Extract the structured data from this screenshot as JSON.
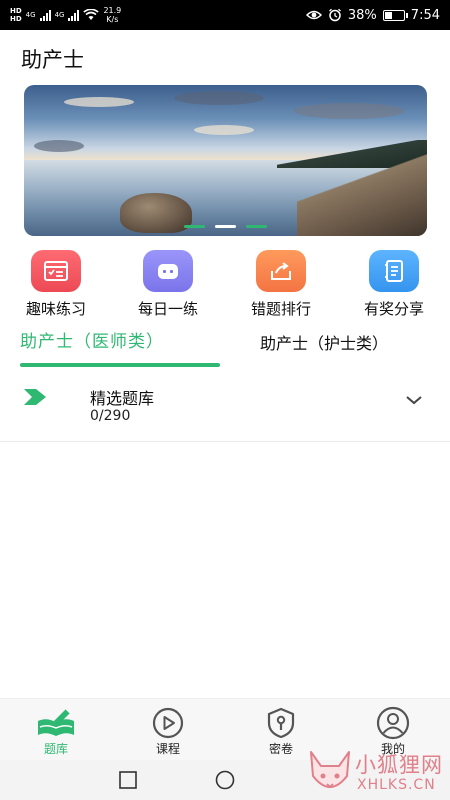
{
  "status_bar": {
    "hd1": "HD",
    "hd2": "HD",
    "net1": "4G",
    "net2": "4G",
    "speed_value": "21.9",
    "speed_unit": "K/s",
    "battery": "38%",
    "battery_level": 0.38,
    "time": "7:54"
  },
  "app": {
    "title": "助产士"
  },
  "banner": {
    "slide_count": 3,
    "active_slide": 2
  },
  "quick_actions": [
    {
      "label": "趣味练习",
      "icon": "practice-icon",
      "color": "#f0555f"
    },
    {
      "label": "每日一练",
      "icon": "robot-icon",
      "color": "#8b86f2"
    },
    {
      "label": "错题排行",
      "icon": "rank-share-icon",
      "color": "#f7874e"
    },
    {
      "label": "有奖分享",
      "icon": "notebook-icon",
      "color": "#3fa2f2"
    }
  ],
  "tabs": [
    {
      "label": "助产士（医师类）",
      "active": true
    },
    {
      "label": "助产士（护士类）",
      "active": false
    }
  ],
  "list": [
    {
      "title": "精选题库",
      "progress": "0/290"
    }
  ],
  "bottom_nav": [
    {
      "label": "题库",
      "icon": "question-bank-icon",
      "active": true
    },
    {
      "label": "课程",
      "icon": "play-course-icon",
      "active": false
    },
    {
      "label": "密卷",
      "icon": "secret-paper-icon",
      "active": false
    },
    {
      "label": "我的",
      "icon": "profile-icon",
      "active": false
    }
  ],
  "watermark": {
    "text_cn": "小狐狸网",
    "text_en": "XHLKS.CN"
  },
  "colors": {
    "accent": "#2eb872",
    "text": "#111111"
  }
}
